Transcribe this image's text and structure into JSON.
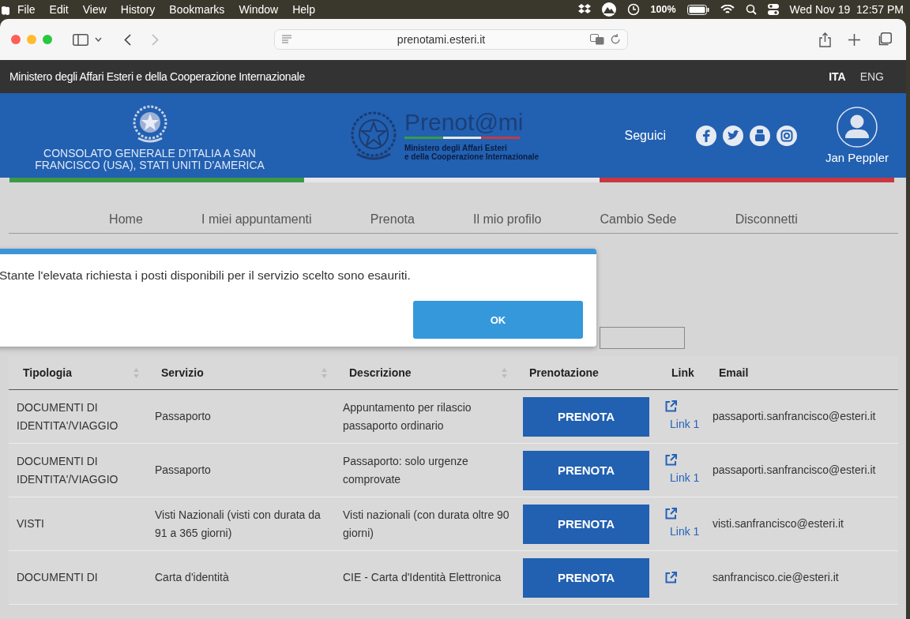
{
  "menubar": {
    "items": [
      "File",
      "Edit",
      "View",
      "History",
      "Bookmarks",
      "Window",
      "Help"
    ],
    "battery": "100%",
    "clock": "Wed Nov 19  12:57 PM"
  },
  "browser": {
    "url": "prenotami.esteri.it"
  },
  "site": {
    "ministry": "Ministero degli Affari Esteri e della Cooperazione Internazionale",
    "languages": [
      {
        "label": "ITA",
        "selected": true
      },
      {
        "label": "ENG",
        "selected": false
      }
    ],
    "consulate": "CONSOLATO GENERALE D'ITALIA A SAN FRANCISCO (USA), STATI UNITI D'AMERICA",
    "logo": {
      "title": "Prenot@mi",
      "subtitle_1": "Ministero degli Affari Esteri",
      "subtitle_2": "e della Cooperazione Internazionale"
    },
    "follow": "Seguici",
    "user": "Jan Peppler"
  },
  "nav": [
    "Home",
    "I miei appuntamenti",
    "Prenota",
    "Il mio profilo",
    "Cambio Sede",
    "Disconnetti"
  ],
  "dialog": {
    "message": "Stante l'elevata richiesta i posti disponibili per il servizio scelto sono esauriti.",
    "button": "OK"
  },
  "table": {
    "columns": [
      {
        "label": "Tipologia",
        "sortable": true
      },
      {
        "label": "Servizio",
        "sortable": true
      },
      {
        "label": "Descrizione",
        "sortable": true
      },
      {
        "label": "Prenotazione",
        "sortable": false
      },
      {
        "label": "Link",
        "sortable": false
      },
      {
        "label": "Email",
        "sortable": false
      }
    ],
    "rows": [
      {
        "tipologia": "DOCUMENTI DI IDENTITA'/VIAGGIO",
        "servizio": "Passaporto",
        "descrizione": "Appuntamento per rilascio passaporto ordinario",
        "button": "PRENOTA",
        "link": "Link 1",
        "email": "passaporti.sanfrancisco@esteri.it"
      },
      {
        "tipologia": "DOCUMENTI DI IDENTITA'/VIAGGIO",
        "servizio": "Passaporto",
        "descrizione": "Passaporto: solo urgenze comprovate",
        "button": "PRENOTA",
        "link": "Link 1",
        "email": "passaporti.sanfrancisco@esteri.it"
      },
      {
        "tipologia": "VISTI",
        "servizio": "Visti Nazionali (visti con durata da 91 a 365 giorni)",
        "descrizione": "Visti nazionali (con durata oltre 90 giorni)",
        "button": "PRENOTA",
        "link": "Link 1",
        "email": "visti.sanfrancisco@esteri.it"
      },
      {
        "tipologia": "DOCUMENTI DI",
        "servizio": "Carta d'identità",
        "descrizione": "CIE - Carta d'Identità Elettronica",
        "button": "PRENOTA",
        "email": "sanfrancisco.cie@esteri.it"
      }
    ]
  }
}
